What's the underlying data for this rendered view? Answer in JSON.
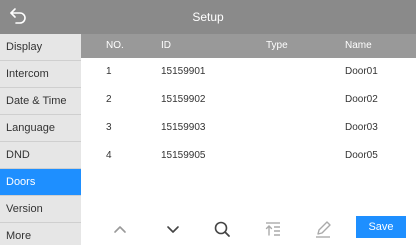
{
  "header": {
    "title": "Setup"
  },
  "sidebar": {
    "items": [
      {
        "label": "Display"
      },
      {
        "label": "Intercom"
      },
      {
        "label": "Date & Time"
      },
      {
        "label": "Language"
      },
      {
        "label": "DND"
      },
      {
        "label": "Doors",
        "active": true
      },
      {
        "label": "Version"
      },
      {
        "label": "More"
      }
    ]
  },
  "table": {
    "columns": [
      "NO.",
      "ID",
      "Type",
      "Name"
    ],
    "rows": [
      {
        "no": "1",
        "id": "15159901",
        "type": "",
        "name": "Door01"
      },
      {
        "no": "2",
        "id": "15159902",
        "type": "",
        "name": "Door02"
      },
      {
        "no": "3",
        "id": "15159903",
        "type": "",
        "name": "Door03"
      },
      {
        "no": "4",
        "id": "15159905",
        "type": "",
        "name": "Door05"
      }
    ]
  },
  "toolbar": {
    "icons": [
      "chevron-up-icon",
      "chevron-down-icon",
      "search-icon",
      "sort-icon",
      "pencil-icon"
    ],
    "save_label": "Save"
  },
  "colors": {
    "accent": "#1e8fff",
    "header_bg": "#8a8a8a",
    "table_header_bg": "#999999",
    "sidebar_bg": "#e6e6e6"
  }
}
